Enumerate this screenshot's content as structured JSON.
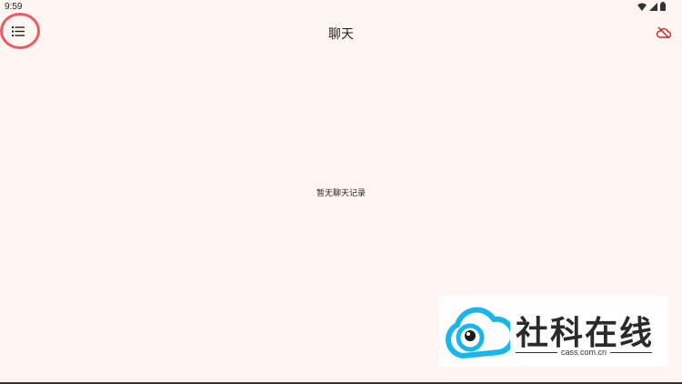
{
  "status_bar": {
    "time": "9:59",
    "icons": [
      "wifi-icon",
      "signal-icon",
      "battery-icon"
    ]
  },
  "app_bar": {
    "title": "聊天",
    "menu_icon": "list-menu-icon",
    "action_icon": "cloud-off-icon"
  },
  "main": {
    "empty_message": "暂无聊天记录"
  },
  "watermark": {
    "title": "社科在线",
    "domain": "cass.com.cn"
  },
  "colors": {
    "background": "#fff6f4",
    "highlight_ring": "#ee5a60",
    "cloud_icon": "#c62828",
    "logo_blue": "#19b6ec"
  }
}
